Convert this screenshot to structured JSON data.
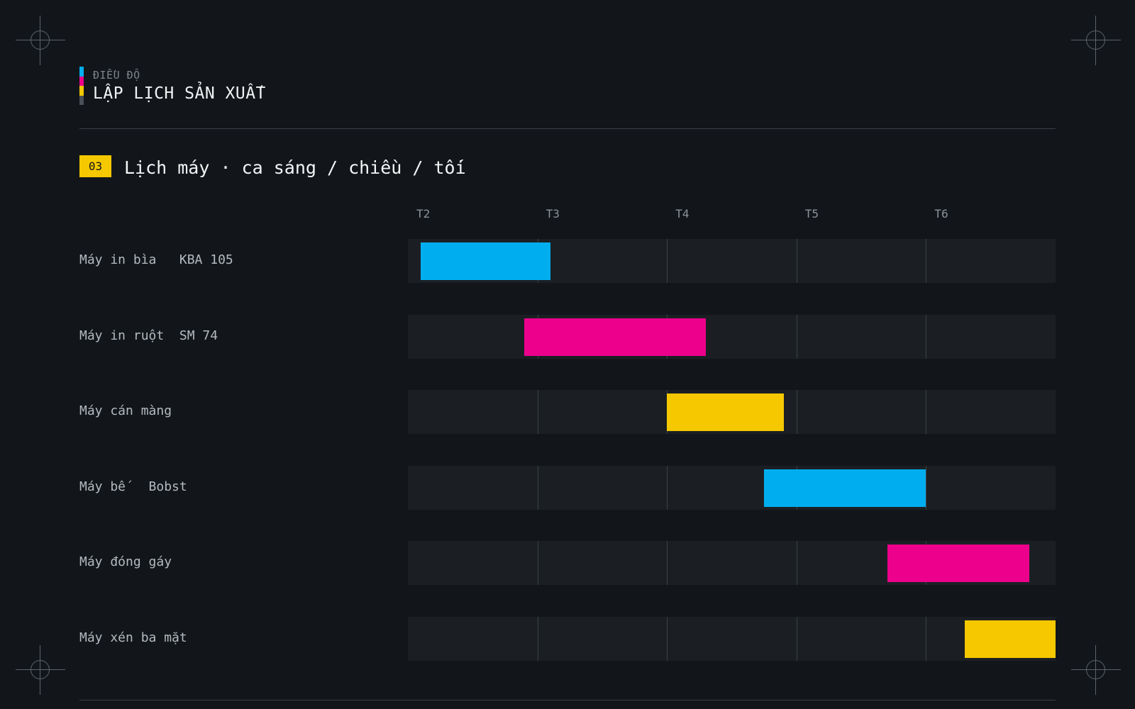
{
  "header": {
    "eyebrow": "ĐIỀU ĐỘ",
    "title": "LẬP LỊCH SẢN XUẤT",
    "bar_colors": [
      "#00aeef",
      "#ec008c",
      "#f5c800",
      "#4a5057"
    ]
  },
  "section": {
    "number": "03",
    "title": "Lịch máy · ca sáng / chiều / tối"
  },
  "chart_data": {
    "type": "gantt",
    "x_ticks": [
      "T2",
      "T3",
      "T4",
      "T5",
      "T6"
    ],
    "xlim": [
      0,
      5
    ],
    "rows": [
      {
        "label": "Máy in bìa   KBA 105",
        "start": 0.1,
        "end": 1.1,
        "color": "#00aeef"
      },
      {
        "label": "Máy in ruột  SM 74",
        "start": 0.9,
        "end": 2.3,
        "color": "#ec008c"
      },
      {
        "label": "Máy cán màng",
        "start": 2.0,
        "end": 2.9,
        "color": "#f5c800"
      },
      {
        "label": "Máy bế   Bobst",
        "start": 2.75,
        "end": 4.0,
        "color": "#00aeef"
      },
      {
        "label": "Máy đóng gáy",
        "start": 3.7,
        "end": 4.8,
        "color": "#ec008c"
      },
      {
        "label": "Máy xén ba mặt",
        "start": 4.3,
        "end": 5.0,
        "color": "#f5c800"
      }
    ]
  }
}
